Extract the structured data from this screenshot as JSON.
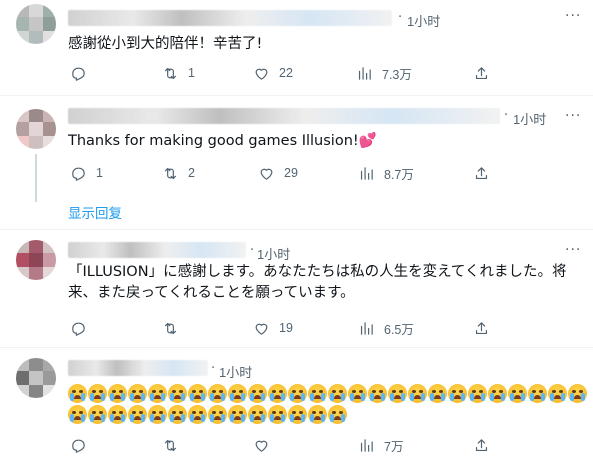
{
  "tweets": [
    {
      "time": "1小时",
      "text": "感謝從小到大的陪伴！辛苦了!",
      "stats": {
        "reply": "",
        "retweet": "1",
        "like": "22",
        "views": "7.3万"
      }
    },
    {
      "time": "1小时",
      "text": "Thanks for making good games Illusion!💕",
      "stats": {
        "reply": "1",
        "retweet": "2",
        "like": "29",
        "views": "8.7万"
      },
      "show_replies": "显示回复"
    },
    {
      "time": "1小时",
      "text": "「ILLUSION」に感謝します。あなたたちは私の人生を変えてくれました。将来、また戻ってくれることを願っています。",
      "stats": {
        "reply": "",
        "retweet": "",
        "like": "19",
        "views": "6.5万"
      }
    },
    {
      "time": "1小时",
      "text": "",
      "emoji": "loudly-crying-face",
      "emoji_count_row1": 26,
      "emoji_count_row2": 14,
      "stats": {
        "reply": "",
        "retweet": "",
        "like": "",
        "views": "7万"
      }
    }
  ],
  "icons": {
    "reply": "reply-icon",
    "retweet": "retweet-icon",
    "like": "like-icon",
    "views": "views-icon",
    "share": "share-icon",
    "more": "more-icon"
  },
  "colors": {
    "link": "#1d9bf0",
    "muted": "#536471",
    "text": "#0f1419",
    "divider": "#eff3f4"
  }
}
